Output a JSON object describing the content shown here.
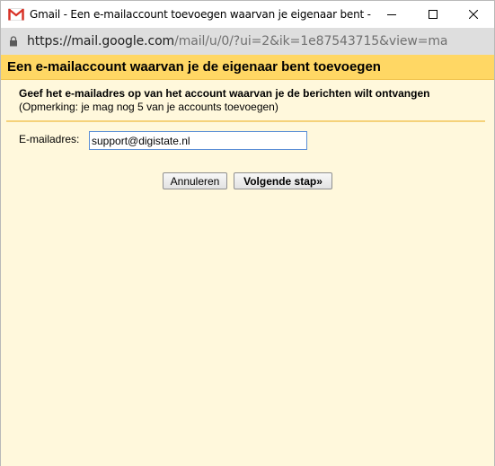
{
  "window": {
    "title": "Gmail - Een e-mailaccount toevoegen waarvan je eigenaar bent - Goo...",
    "controls": {
      "minimize_icon": "minimize-icon",
      "maximize_icon": "maximize-icon",
      "close_icon": "close-icon"
    }
  },
  "address_bar": {
    "url_scheme_host": "https://mail.google.com",
    "url_path": "/mail/u/0/?ui=2&ik=1e87543715&view=ma"
  },
  "dialog": {
    "heading": "Een e-mailaccount waarvan je de eigenaar bent toevoegen",
    "instruction_line1": "Geef het e-mailadres op van het account waarvan je de berichten wilt ontvangen",
    "instruction_line2": "(Opmerking: je mag nog 5 van je accounts toevoegen)",
    "email_label": "E-mailadres:",
    "email_value": "support@digistate.nl",
    "cancel_label": "Annuleren",
    "next_label": "Volgende stap»"
  },
  "colors": {
    "header_band": "#ffd764",
    "panel_background": "#fff8dc",
    "address_bar": "#dedede",
    "gmail_red": "#d93025"
  }
}
